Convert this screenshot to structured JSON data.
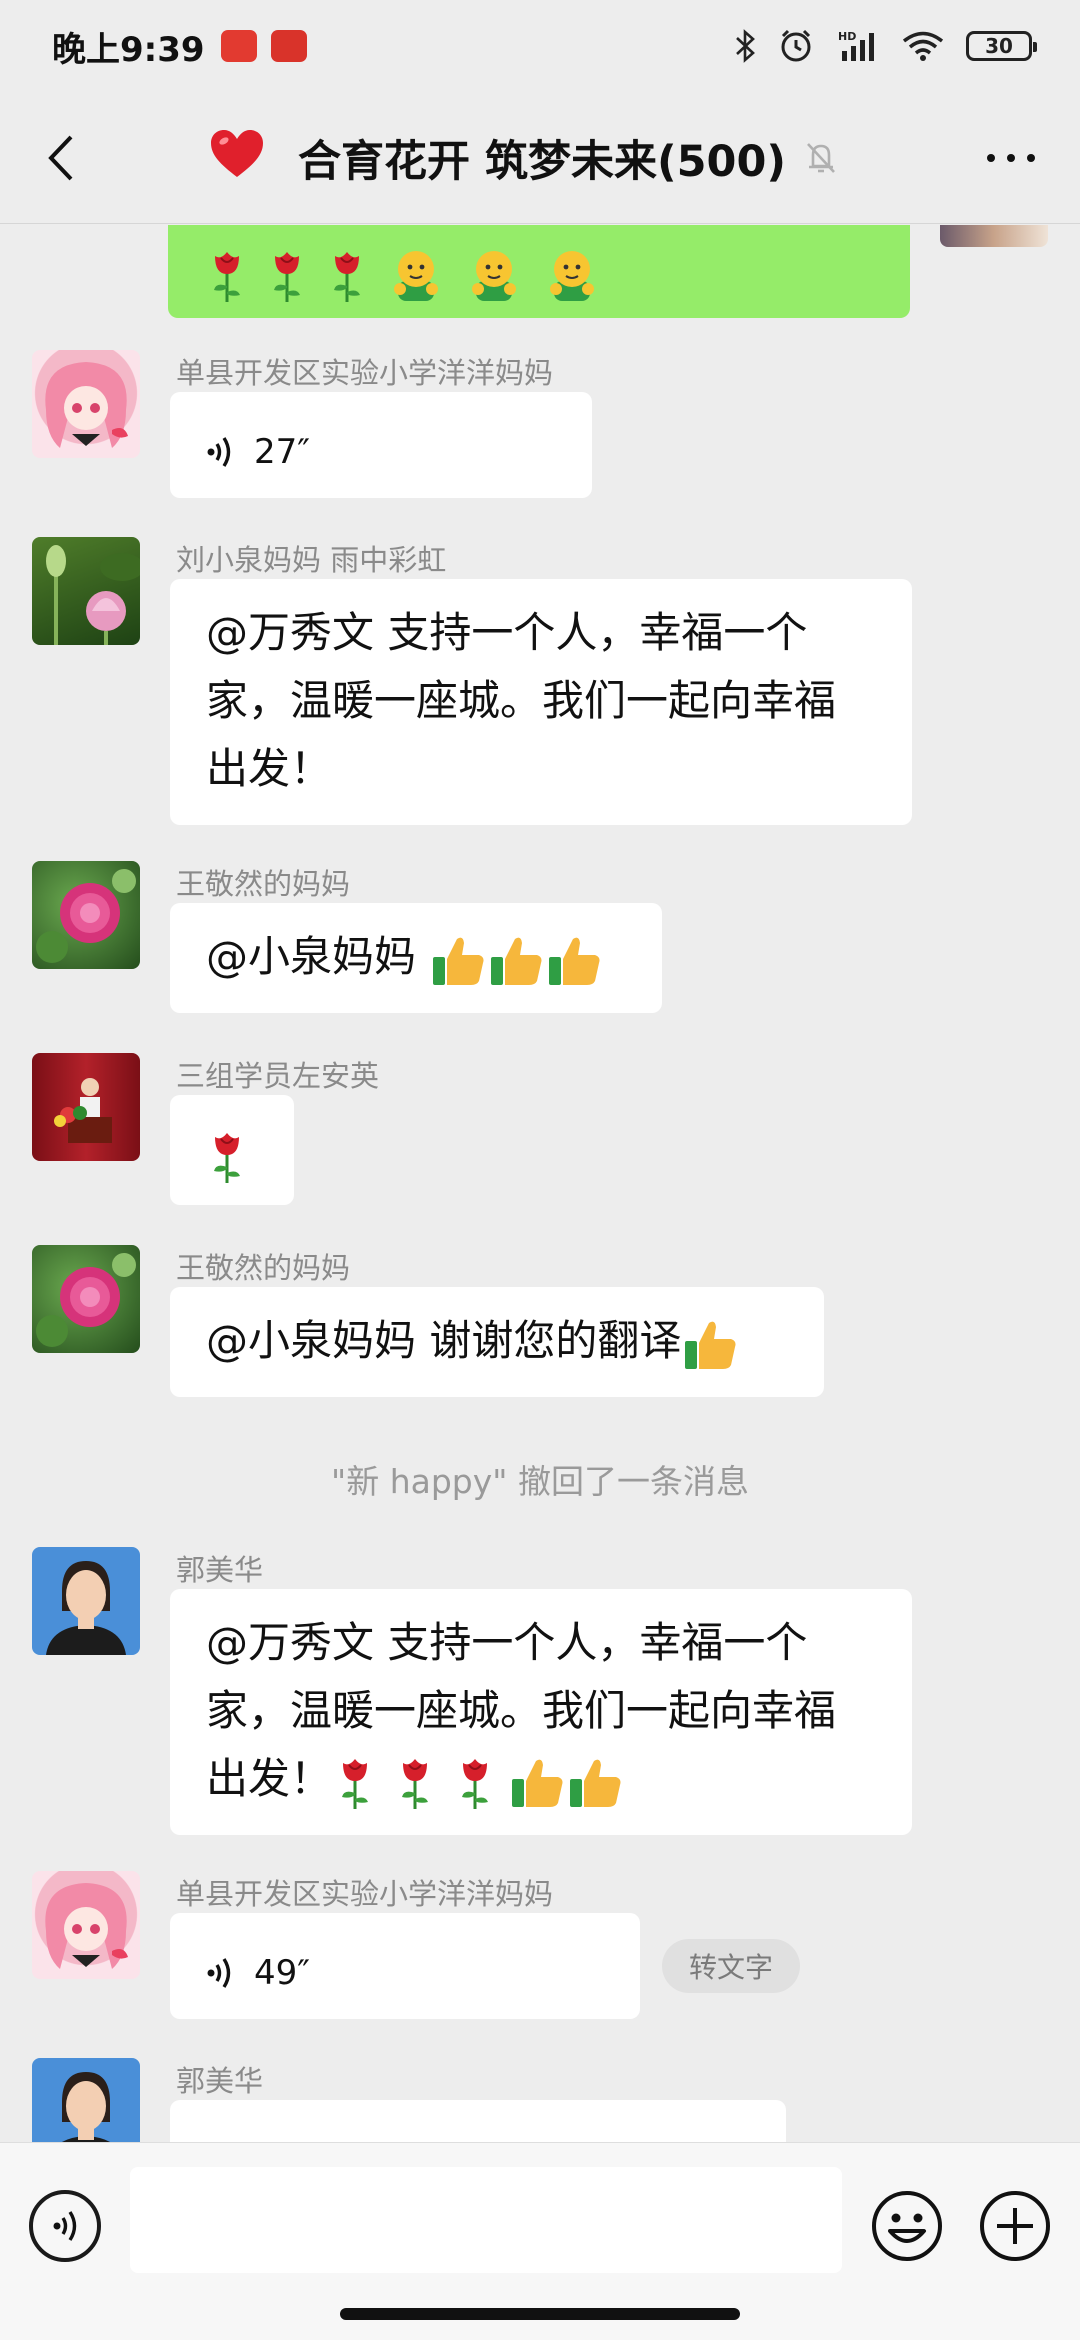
{
  "status_bar": {
    "time": "晚上9:39",
    "app_icon_1": "",
    "app_icon_2": "",
    "battery": "30"
  },
  "header": {
    "title": "合育花开 筑梦未来(500)",
    "icons": [
      "back-icon",
      "heart-icon",
      "mute-bell-icon",
      "more-icon"
    ]
  },
  "messages": [
    {
      "sender": "单县开发区实验小学洋洋妈妈",
      "type": "voice",
      "duration": "27″"
    },
    {
      "sender": "刘小泉妈妈  雨中彩虹",
      "type": "text",
      "lines": [
        "@万秀文  支持一个人，幸福一个",
        "家，温暖一座城。我们一起向幸福",
        "出发！"
      ]
    },
    {
      "sender": "王敬然的妈妈",
      "type": "text",
      "text": "@小泉妈妈 "
    },
    {
      "sender": "三组学员左安英",
      "type": "emoji"
    },
    {
      "sender": "王敬然的妈妈",
      "type": "text",
      "text": "@小泉妈妈  谢谢您的翻译"
    },
    {
      "sender": "郭美华",
      "type": "text",
      "lines": [
        "@万秀文  支持一个人，幸福一个",
        "家，温暖一座城。我们一起向幸福",
        "出发！"
      ]
    },
    {
      "sender": "单县开发区实验小学洋洋妈妈",
      "type": "voice",
      "duration": "49″",
      "action": "转文字"
    },
    {
      "sender": "郭美华",
      "type": "text"
    }
  ],
  "recall_notice": "\"新 happy\" 撤回了一条消息",
  "input": {
    "placeholder": "",
    "value": ""
  },
  "colors": {
    "background": "#ededed",
    "self_bubble": "#95ec69",
    "other_bubble": "#ffffff",
    "heart": "#e0202c"
  }
}
